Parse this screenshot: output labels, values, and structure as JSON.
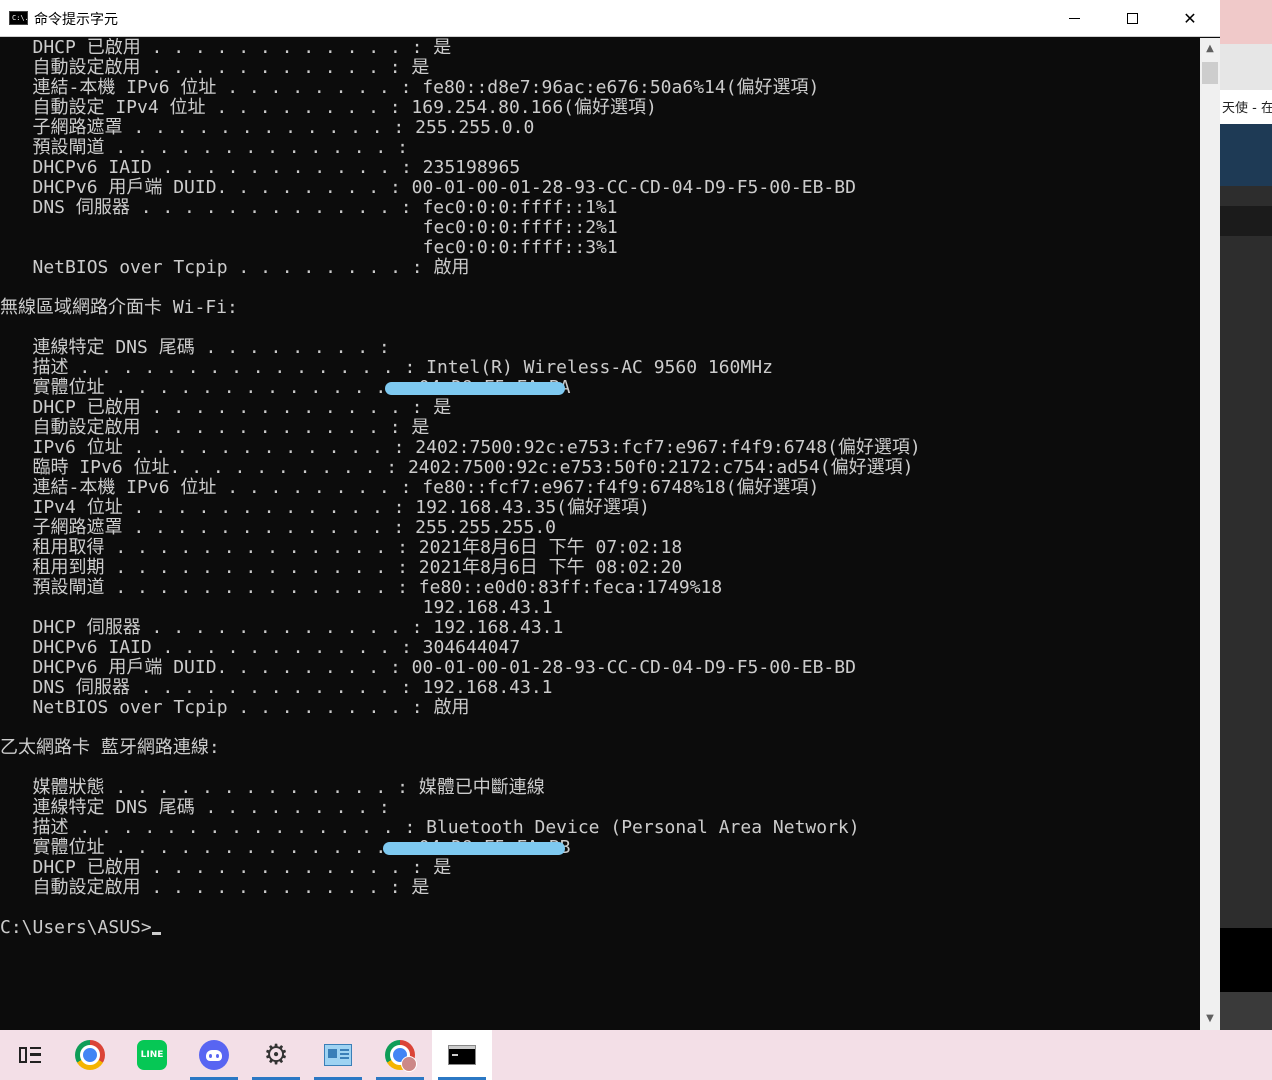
{
  "window": {
    "title": "命令提示字元",
    "icon": "cmd-window-icon",
    "icon_text": "C:\\.",
    "controls": [
      "minimize",
      "maximize",
      "close"
    ]
  },
  "console": {
    "lines": [
      "   DHCP 已啟用 . . . . . . . . . . . . : 是",
      "   自動設定啟用 . . . . . . . . . . . : 是",
      "   連結-本機 IPv6 位址 . . . . . . . . : fe80::d8e7:96ac:e676:50a6%14(偏好選項)",
      "   自動設定 IPv4 位址 . . . . . . . . : 169.254.80.166(偏好選項)",
      "   子網路遮罩 . . . . . . . . . . . . : 255.255.0.0",
      "   預設閘道 . . . . . . . . . . . . . :",
      "   DHCPv6 IAID . . . . . . . . . . . : 235198965",
      "   DHCPv6 用戶端 DUID. . . . . . . . : 00-01-00-01-28-93-CC-CD-04-D9-F5-00-EB-BD",
      "   DNS 伺服器 . . . . . . . . . . . . : fec0:0:0:ffff::1%1",
      "                                       fec0:0:0:ffff::2%1",
      "                                       fec0:0:0:ffff::3%1",
      "   NetBIOS over Tcpip . . . . . . . . : 啟用",
      "",
      "無線區域網路介面卡 Wi-Fi:",
      "",
      "   連線特定 DNS 尾碼 . . . . . . . . :",
      "   描述 . . . . . . . . . . . . . . . : Intel(R) Wireless-AC 9560 160MHz",
      "   實體位址 . . . . . . . . . . . . . : 04-D9-F5-FA-BA",
      "   DHCP 已啟用 . . . . . . . . . . . . : 是",
      "   自動設定啟用 . . . . . . . . . . . : 是",
      "   IPv6 位址 . . . . . . . . . . . . : 2402:7500:92c:e753:fcf7:e967:f4f9:6748(偏好選項)",
      "   臨時 IPv6 位址. . . . . . . . . . : 2402:7500:92c:e753:50f0:2172:c754:ad54(偏好選項)",
      "   連結-本機 IPv6 位址 . . . . . . . . : fe80::fcf7:e967:f4f9:6748%18(偏好選項)",
      "   IPv4 位址 . . . . . . . . . . . . : 192.168.43.35(偏好選項)",
      "   子網路遮罩 . . . . . . . . . . . . : 255.255.255.0",
      "   租用取得 . . . . . . . . . . . . . : 2021年8月6日 下午 07:02:18",
      "   租用到期 . . . . . . . . . . . . . : 2021年8月6日 下午 08:02:20",
      "   預設閘道 . . . . . . . . . . . . . : fe80::e0d0:83ff:feca:1749%18",
      "                                       192.168.43.1",
      "   DHCP 伺服器 . . . . . . . . . . . . : 192.168.43.1",
      "   DHCPv6 IAID . . . . . . . . . . . : 304644047",
      "   DHCPv6 用戶端 DUID. . . . . . . . : 00-01-00-01-28-93-CC-CD-04-D9-F5-00-EB-BD",
      "   DNS 伺服器 . . . . . . . . . . . . : 192.168.43.1",
      "   NetBIOS over Tcpip . . . . . . . . : 啟用",
      "",
      "乙太網路卡 藍牙網路連線:",
      "",
      "   媒體狀態 . . . . . . . . . . . . . : 媒體已中斷連線",
      "   連線特定 DNS 尾碼 . . . . . . . . :",
      "   描述 . . . . . . . . . . . . . . . : Bluetooth Device (Personal Area Network)",
      "   實體位址 . . . . . . . . . . . . . : 04-D9-F5-FA-BB",
      "   DHCP 已啟用 . . . . . . . . . . . . : 是",
      "   自動設定啟用 . . . . . . . . . . . : 是",
      ""
    ],
    "prompt": "C:\\Users\\ASUS>",
    "redaction_color": "#7ec9f0",
    "text_color": "#cccccc",
    "background_color": "#0c0c0c"
  },
  "background_window": {
    "tab_text": "天使 - 在"
  },
  "taskbar": {
    "items": [
      {
        "name": "task-view",
        "icon": "task-view-icon",
        "active": false,
        "running": false
      },
      {
        "name": "chrome",
        "icon": "chrome-icon",
        "active": false,
        "running": false
      },
      {
        "name": "line",
        "icon": "line-icon",
        "label": "LINE",
        "active": false,
        "running": false
      },
      {
        "name": "discord",
        "icon": "discord-icon",
        "active": false,
        "running": true
      },
      {
        "name": "settings",
        "icon": "gear-icon",
        "active": false,
        "running": true
      },
      {
        "name": "control-panel",
        "icon": "control-panel-icon",
        "active": false,
        "running": true
      },
      {
        "name": "chrome-profile",
        "icon": "chrome-icon",
        "active": false,
        "running": true
      },
      {
        "name": "command-prompt",
        "icon": "cmd-icon",
        "active": true,
        "running": true
      }
    ],
    "accent_color": "#2b78c4"
  }
}
